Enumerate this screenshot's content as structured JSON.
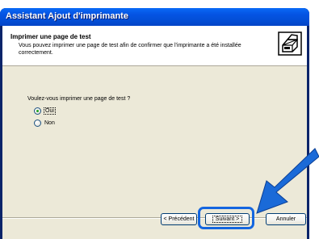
{
  "window": {
    "title": "Assistant Ajout d'imprimante"
  },
  "header": {
    "title": "Imprimer une page de test",
    "description": "Vous pouvez imprimer une page de test afin de confirmer que l'imprimante a été installée correctement."
  },
  "question": "Voulez-vous imprimer une page de test ?",
  "options": [
    {
      "label": "Oui",
      "checked": true
    },
    {
      "label": "Non",
      "checked": false
    }
  ],
  "buttons": {
    "back_label": "< Précédent",
    "next_label": "Suivant >",
    "cancel_label": "Annuler"
  },
  "colors": {
    "titlebar": "#0554e3",
    "dialog_bg": "#ece9d8",
    "highlight": "#1466e0",
    "arrow": "#1a6ad8"
  },
  "icons": {
    "header_icon": "printer-icon",
    "pointer": "arrow-pointer-icon"
  }
}
